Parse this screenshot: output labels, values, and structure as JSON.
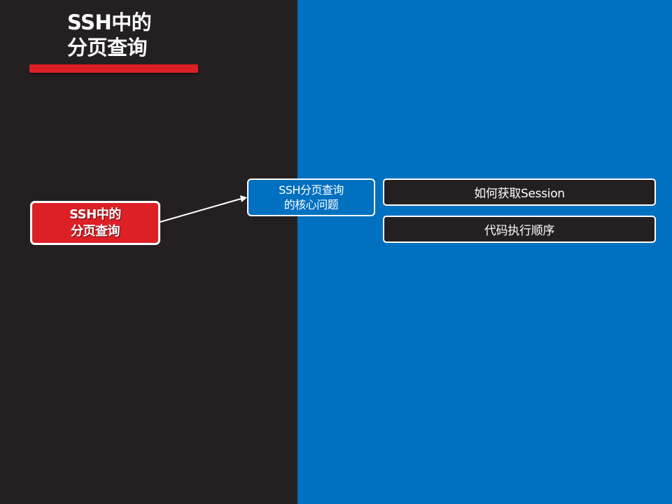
{
  "slide": {
    "title_line1": "SSH中的",
    "title_line2": "分页查询"
  },
  "root_node": {
    "line1": "SSH中的",
    "line2": "分页查询"
  },
  "mid_node": {
    "line1": "SSH分页查询",
    "line2": "的核心问题"
  },
  "leaf_nodes": [
    {
      "label": "如何获取Session"
    },
    {
      "label": "代码执行顺序"
    }
  ],
  "colors": {
    "left_panel": "#242021",
    "right_panel": "#0070c0",
    "accent_red": "#dd1f26",
    "text": "#ffffff"
  }
}
